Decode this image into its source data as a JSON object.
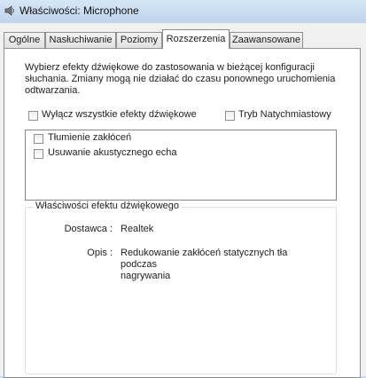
{
  "window": {
    "title": "Właściwości: Microphone"
  },
  "tabs": [
    {
      "label": "Ogólne"
    },
    {
      "label": "Nasłuchiwanie"
    },
    {
      "label": "Poziomy"
    },
    {
      "label": "Rozszerzenia",
      "active": true
    },
    {
      "label": "Zaawansowane"
    }
  ],
  "enhancements": {
    "description_line1": "Wybierz efekty dźwiękowe do zastosowania w bieżącej konfiguracji",
    "description_line2": "słuchania. Zmiany mogą nie działać do czasu ponownego uruchomienia",
    "description_line3": "odtwarzania.",
    "disable_all_label": "Wyłącz wszystkie efekty dźwiękowe",
    "disable_all_checked": false,
    "immediate_mode_label": "Tryb Natychmiastowy",
    "immediate_mode_checked": false,
    "effects": [
      {
        "label": "Tłumienie zakłóceń",
        "checked": false
      },
      {
        "label": "Usuwanie akustycznego echa",
        "checked": false
      }
    ],
    "properties": {
      "group_title": "Właściwości efektu dźwiękowego",
      "provider_label": "Dostawca :",
      "provider_value": "Realtek",
      "description_label": "Opis :",
      "description_value_line1": "Redukowanie zakłóceń statycznych tła podczas",
      "description_value_line2": "nagrywania"
    }
  }
}
